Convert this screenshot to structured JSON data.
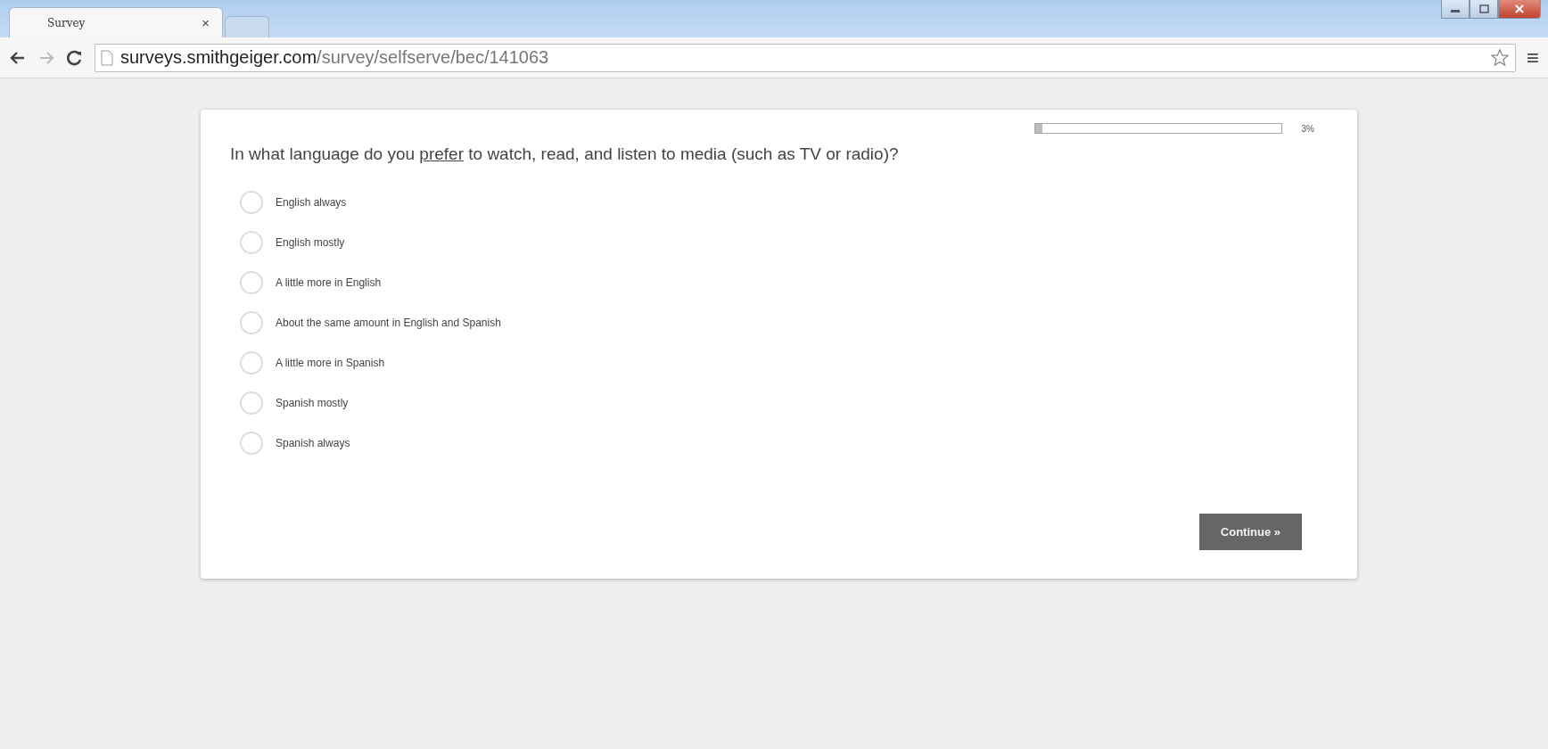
{
  "browser": {
    "tabs": [
      {
        "title": "Survey",
        "close": "×",
        "selected": true
      },
      {
        "selected": false
      }
    ],
    "url": {
      "host": "surveys.smithgeiger.com",
      "path": "/survey/selfserve/bec/141063"
    },
    "menu": "≡"
  },
  "survey": {
    "progress": {
      "level": 0.03,
      "reading": "3%"
    },
    "question": {
      "before": "In what language do you ",
      "underlined": "prefer",
      "after": " to watch, read, and listen to media (such as TV or radio)?"
    },
    "options": [
      {
        "label": "English always",
        "selected": false
      },
      {
        "label": "English mostly",
        "selected": false
      },
      {
        "label": "A little more in English",
        "selected": false
      },
      {
        "label": "About the same amount in English and Spanish",
        "selected": false
      },
      {
        "label": "A little more in Spanish",
        "selected": false
      },
      {
        "label": "Spanish mostly",
        "selected": false
      },
      {
        "label": "Spanish always",
        "selected": false
      }
    ],
    "continue_button": "Continue »"
  }
}
